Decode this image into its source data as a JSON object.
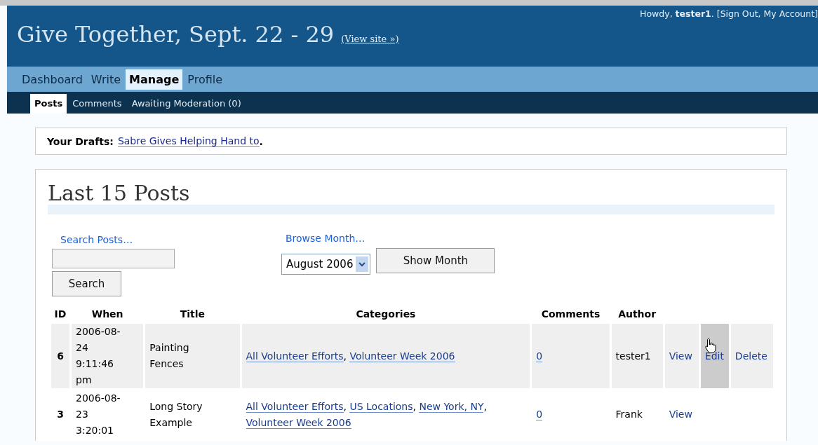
{
  "header": {
    "title": "Give Together, Sept. 22 - 29",
    "view_site": "(View site »)",
    "greeting": "Howdy,",
    "user": "tester1",
    "user_links": ". [Sign Out, My Account]"
  },
  "menu": [
    {
      "label": "Dashboard",
      "selected": false
    },
    {
      "label": "Write",
      "selected": false
    },
    {
      "label": "Manage",
      "selected": true
    },
    {
      "label": "Profile",
      "selected": false
    }
  ],
  "submenu": [
    {
      "label": "Posts",
      "selected": true
    },
    {
      "label": "Comments",
      "selected": false
    },
    {
      "label": "Awaiting Moderation (0)",
      "selected": false
    }
  ],
  "drafts": {
    "label": "Your Drafts:",
    "link": "Sabre Gives Helping Hand to",
    "end": "."
  },
  "posts": {
    "heading": "Last 15 Posts",
    "search_label": "Search Posts…",
    "search_button": "Search",
    "browse_label": "Browse Month…",
    "month": "August 2006",
    "show_button": "Show Month",
    "columns": [
      "ID",
      "When",
      "Title",
      "Categories",
      "Comments",
      "Author"
    ],
    "rows": [
      {
        "id": "6",
        "when": [
          "2006-08-",
          "24",
          "9:11:46",
          "pm"
        ],
        "title": "Painting Fences",
        "categories": [
          {
            "label": "All Volunteer Efforts",
            "after": ","
          },
          {
            "label": "Volunteer Week 2006"
          }
        ],
        "comments": "0",
        "author": "tester1",
        "shaded": true,
        "actions": [
          {
            "label": "View",
            "hovered": false
          },
          {
            "label": "Edit",
            "hovered": true
          },
          {
            "label": "Delete",
            "hovered": false
          }
        ]
      },
      {
        "id": "3",
        "when": [
          "2006-08-",
          "23",
          "3:20:01"
        ],
        "title": "Long Story Example",
        "categories": [
          {
            "label": "All Volunteer Efforts",
            "after": ","
          },
          {
            "label": "US Locations",
            "after": ","
          },
          {
            "label": "New York, NY",
            "after": ","
          },
          {
            "label": "Volunteer Week 2006"
          }
        ],
        "comments": "0",
        "author": "Frank",
        "shaded": false,
        "actions": [
          {
            "label": "View",
            "hovered": false
          }
        ]
      }
    ]
  }
}
